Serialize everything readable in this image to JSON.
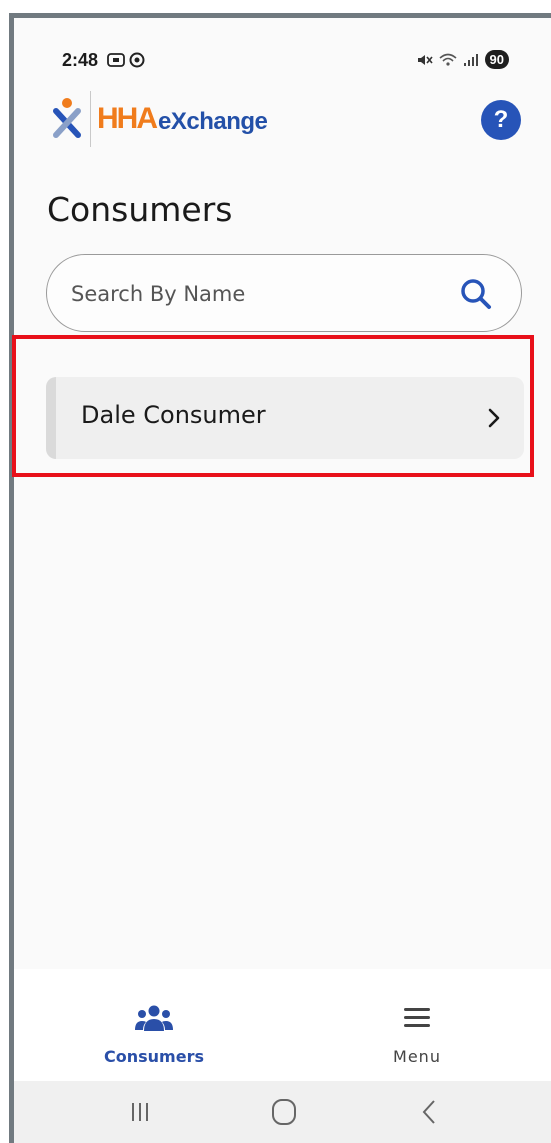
{
  "status_bar": {
    "time": "2:48",
    "left_icons": "screenshot-icon, sync-icon",
    "right_icons": "mute-icon, wifi-icon, signal-icon",
    "battery": "90"
  },
  "header": {
    "logo_hha": "HHA",
    "logo_exchange": "eXchange",
    "help_label": "?"
  },
  "page": {
    "title": "Consumers"
  },
  "search": {
    "placeholder": "Search By Name",
    "value": ""
  },
  "consumers": [
    {
      "name": "Dale Consumer"
    }
  ],
  "bottom_nav": {
    "items": [
      {
        "label": "Consumers",
        "icon": "users-icon",
        "active": true
      },
      {
        "label": "Menu",
        "icon": "hamburger-icon",
        "active": false
      }
    ]
  },
  "colors": {
    "brand_orange": "#f07c1c",
    "brand_blue": "#2754b8",
    "highlight_red": "#e8101a",
    "active_nav": "#2a4fa8"
  }
}
